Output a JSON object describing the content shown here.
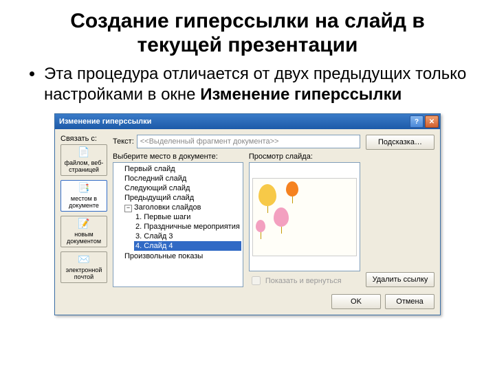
{
  "slide": {
    "title": "Создание гиперссылки на слайд в текущей презентации",
    "bullet_pre": "Эта процедура отличается от двух предыдущих только настройками в окне ",
    "bullet_bold": "Изменение гиперссылки"
  },
  "dialog": {
    "title": "Изменение гиперссылки",
    "link_to_label": "Связать с:",
    "side": [
      {
        "label": "файлом, веб-страницей"
      },
      {
        "label": "местом в документе"
      },
      {
        "label": "новым документом"
      },
      {
        "label": "электронной почтой"
      }
    ],
    "text_label": "Текст:",
    "text_value": "<<Выделенный фрагмент документа>>",
    "tip_btn": "Подсказка…",
    "select_label": "Выберите место в документе:",
    "preview_label": "Просмотр слайда:",
    "tree": {
      "first": "Первый слайд",
      "last": "Последний слайд",
      "next": "Следующий слайд",
      "prev": "Предыдущий слайд",
      "headers": "Заголовки слайдов",
      "items": [
        "1. Первые шаги",
        "2. Праздничные мероприятия",
        "3. Слайд 3",
        "4. Слайд 4"
      ],
      "custom": "Произвольные показы"
    },
    "show_return": "Показать и вернуться",
    "remove_btn": "Удалить ссылку",
    "ok": "OK",
    "cancel": "Отмена"
  }
}
